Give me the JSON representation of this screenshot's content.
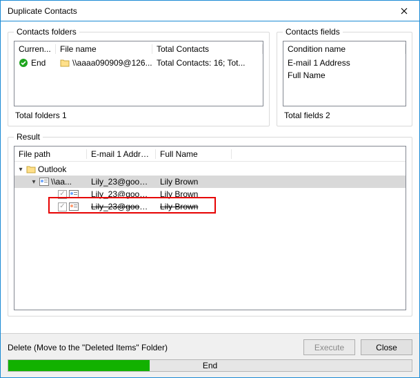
{
  "title": "Duplicate Contacts",
  "folders": {
    "legend": "Contacts folders",
    "headers": {
      "c1": "Curren...",
      "c2": "File name",
      "c3": "Total Contacts"
    },
    "row": {
      "status": "End",
      "filename": "\\\\aaaa090909@126...",
      "total": "Total Contacts: 16; Tot..."
    },
    "summary": "Total folders  1"
  },
  "fields": {
    "legend": "Contacts fields",
    "header": "Condition name",
    "items": [
      "E-mail 1 Address",
      "Full Name"
    ],
    "summary": "Total fields  2"
  },
  "result": {
    "legend": "Result",
    "headers": {
      "c1": "File path",
      "c2": "E-mail 1 Address",
      "c3": "Full Name"
    },
    "tree": {
      "root": "Outlook",
      "group": {
        "path": "\\\\aa...",
        "email": "Lily_23@google...",
        "name": "Lily Brown"
      },
      "items": [
        {
          "email": "Lily_23@google...",
          "name": "Lily Brown",
          "strike": false
        },
        {
          "email": "Lily_23@google...",
          "name": "Lily Brown",
          "strike": true
        }
      ]
    }
  },
  "footer": {
    "label": "Delete (Move to the \"Deleted Items\" Folder)",
    "execute": "Execute",
    "close": "Close",
    "progress_text": "End"
  }
}
